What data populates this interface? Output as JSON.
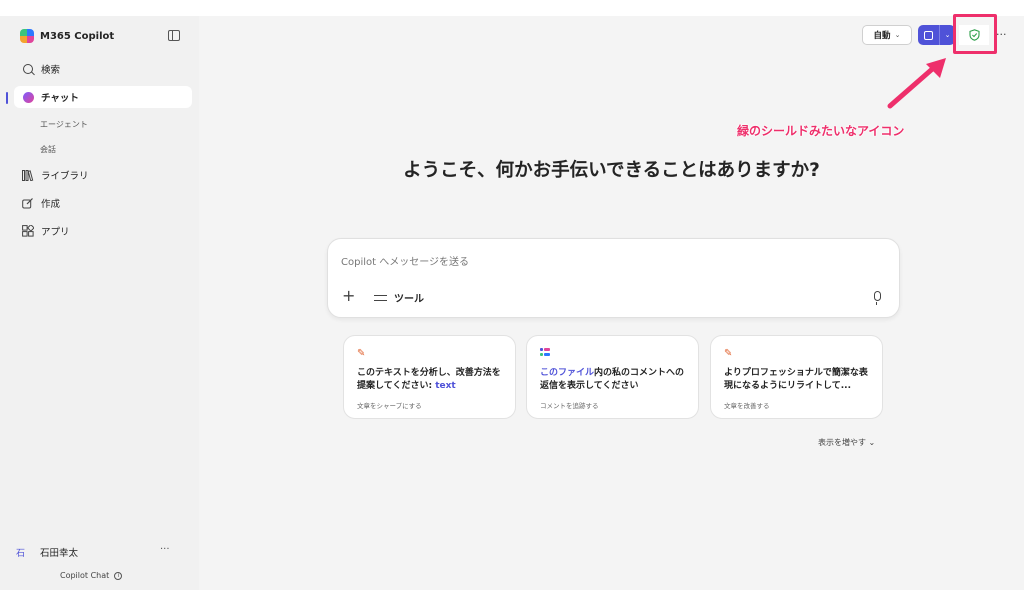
{
  "sidebar": {
    "brand": "M365 Copilot",
    "nav": [
      {
        "label": "検索",
        "icon": "search-icon"
      },
      {
        "label": "チャット",
        "icon": "chat-icon"
      },
      {
        "label": "ライブラリ",
        "icon": "library-icon"
      },
      {
        "label": "作成",
        "icon": "create-icon"
      },
      {
        "label": "アプリ",
        "icon": "apps-icon"
      }
    ],
    "sub_items": [
      "エージェント",
      "会話"
    ],
    "user": {
      "avatar": "石",
      "name": "石田幸太"
    },
    "footer": "Copilot Chat"
  },
  "toolbar": {
    "mode": "自動",
    "shield_color": "#2e9f4a",
    "accent_color": "#4f52d8"
  },
  "annotation": {
    "text": "緑のシールドみたいなアイコン",
    "color": "#ee2f6b"
  },
  "main": {
    "welcome": "ようこそ、何かお手伝いできることはありますか?",
    "composer_placeholder": "Copilot へメッセージを送る",
    "tools_label": "ツール",
    "cards": [
      {
        "title_pre": "このテキストを分析し、改善方法を提案してください: ",
        "title_accent": "text",
        "title_post": "",
        "sub": "文章をシャープにする",
        "icon": "pencil-icon"
      },
      {
        "title_pre": "",
        "title_accent": "このファイル",
        "title_post": "内の私のコメントへの返信を表示してください",
        "sub": "コメントを追跡する",
        "icon": "file-list-icon"
      },
      {
        "title_pre": "よりプロフェッショナルで簡潔な表現になるようにリライトして...",
        "title_accent": "",
        "title_post": "",
        "sub": "文章を改善する",
        "icon": "pencil-icon"
      }
    ],
    "show_more": "表示を増やす"
  }
}
